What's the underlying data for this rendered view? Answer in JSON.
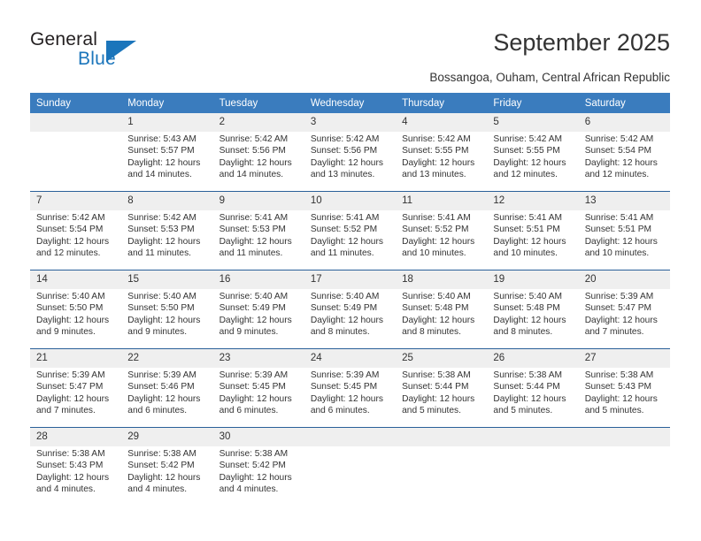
{
  "brand": {
    "name_part1": "General",
    "name_part2": "Blue"
  },
  "header": {
    "title": "September 2025",
    "subtitle": "Bossangoa, Ouham, Central African Republic"
  },
  "colors": {
    "header_blue": "#3a7cbe",
    "rule_blue": "#2a6099",
    "daynum_band": "#efefef",
    "brand_blue": "#1b75bb",
    "text": "#333333"
  },
  "weekday_headers": [
    "Sunday",
    "Monday",
    "Tuesday",
    "Wednesday",
    "Thursday",
    "Friday",
    "Saturday"
  ],
  "weeks": [
    {
      "days": [
        {
          "date": "",
          "sunrise": "",
          "sunset": "",
          "daylight": ""
        },
        {
          "date": "1",
          "sunrise": "Sunrise: 5:43 AM",
          "sunset": "Sunset: 5:57 PM",
          "daylight": "Daylight: 12 hours and 14 minutes."
        },
        {
          "date": "2",
          "sunrise": "Sunrise: 5:42 AM",
          "sunset": "Sunset: 5:56 PM",
          "daylight": "Daylight: 12 hours and 14 minutes."
        },
        {
          "date": "3",
          "sunrise": "Sunrise: 5:42 AM",
          "sunset": "Sunset: 5:56 PM",
          "daylight": "Daylight: 12 hours and 13 minutes."
        },
        {
          "date": "4",
          "sunrise": "Sunrise: 5:42 AM",
          "sunset": "Sunset: 5:55 PM",
          "daylight": "Daylight: 12 hours and 13 minutes."
        },
        {
          "date": "5",
          "sunrise": "Sunrise: 5:42 AM",
          "sunset": "Sunset: 5:55 PM",
          "daylight": "Daylight: 12 hours and 12 minutes."
        },
        {
          "date": "6",
          "sunrise": "Sunrise: 5:42 AM",
          "sunset": "Sunset: 5:54 PM",
          "daylight": "Daylight: 12 hours and 12 minutes."
        }
      ]
    },
    {
      "days": [
        {
          "date": "7",
          "sunrise": "Sunrise: 5:42 AM",
          "sunset": "Sunset: 5:54 PM",
          "daylight": "Daylight: 12 hours and 12 minutes."
        },
        {
          "date": "8",
          "sunrise": "Sunrise: 5:42 AM",
          "sunset": "Sunset: 5:53 PM",
          "daylight": "Daylight: 12 hours and 11 minutes."
        },
        {
          "date": "9",
          "sunrise": "Sunrise: 5:41 AM",
          "sunset": "Sunset: 5:53 PM",
          "daylight": "Daylight: 12 hours and 11 minutes."
        },
        {
          "date": "10",
          "sunrise": "Sunrise: 5:41 AM",
          "sunset": "Sunset: 5:52 PM",
          "daylight": "Daylight: 12 hours and 11 minutes."
        },
        {
          "date": "11",
          "sunrise": "Sunrise: 5:41 AM",
          "sunset": "Sunset: 5:52 PM",
          "daylight": "Daylight: 12 hours and 10 minutes."
        },
        {
          "date": "12",
          "sunrise": "Sunrise: 5:41 AM",
          "sunset": "Sunset: 5:51 PM",
          "daylight": "Daylight: 12 hours and 10 minutes."
        },
        {
          "date": "13",
          "sunrise": "Sunrise: 5:41 AM",
          "sunset": "Sunset: 5:51 PM",
          "daylight": "Daylight: 12 hours and 10 minutes."
        }
      ]
    },
    {
      "days": [
        {
          "date": "14",
          "sunrise": "Sunrise: 5:40 AM",
          "sunset": "Sunset: 5:50 PM",
          "daylight": "Daylight: 12 hours and 9 minutes."
        },
        {
          "date": "15",
          "sunrise": "Sunrise: 5:40 AM",
          "sunset": "Sunset: 5:50 PM",
          "daylight": "Daylight: 12 hours and 9 minutes."
        },
        {
          "date": "16",
          "sunrise": "Sunrise: 5:40 AM",
          "sunset": "Sunset: 5:49 PM",
          "daylight": "Daylight: 12 hours and 9 minutes."
        },
        {
          "date": "17",
          "sunrise": "Sunrise: 5:40 AM",
          "sunset": "Sunset: 5:49 PM",
          "daylight": "Daylight: 12 hours and 8 minutes."
        },
        {
          "date": "18",
          "sunrise": "Sunrise: 5:40 AM",
          "sunset": "Sunset: 5:48 PM",
          "daylight": "Daylight: 12 hours and 8 minutes."
        },
        {
          "date": "19",
          "sunrise": "Sunrise: 5:40 AM",
          "sunset": "Sunset: 5:48 PM",
          "daylight": "Daylight: 12 hours and 8 minutes."
        },
        {
          "date": "20",
          "sunrise": "Sunrise: 5:39 AM",
          "sunset": "Sunset: 5:47 PM",
          "daylight": "Daylight: 12 hours and 7 minutes."
        }
      ]
    },
    {
      "days": [
        {
          "date": "21",
          "sunrise": "Sunrise: 5:39 AM",
          "sunset": "Sunset: 5:47 PM",
          "daylight": "Daylight: 12 hours and 7 minutes."
        },
        {
          "date": "22",
          "sunrise": "Sunrise: 5:39 AM",
          "sunset": "Sunset: 5:46 PM",
          "daylight": "Daylight: 12 hours and 6 minutes."
        },
        {
          "date": "23",
          "sunrise": "Sunrise: 5:39 AM",
          "sunset": "Sunset: 5:45 PM",
          "daylight": "Daylight: 12 hours and 6 minutes."
        },
        {
          "date": "24",
          "sunrise": "Sunrise: 5:39 AM",
          "sunset": "Sunset: 5:45 PM",
          "daylight": "Daylight: 12 hours and 6 minutes."
        },
        {
          "date": "25",
          "sunrise": "Sunrise: 5:38 AM",
          "sunset": "Sunset: 5:44 PM",
          "daylight": "Daylight: 12 hours and 5 minutes."
        },
        {
          "date": "26",
          "sunrise": "Sunrise: 5:38 AM",
          "sunset": "Sunset: 5:44 PM",
          "daylight": "Daylight: 12 hours and 5 minutes."
        },
        {
          "date": "27",
          "sunrise": "Sunrise: 5:38 AM",
          "sunset": "Sunset: 5:43 PM",
          "daylight": "Daylight: 12 hours and 5 minutes."
        }
      ]
    },
    {
      "days": [
        {
          "date": "28",
          "sunrise": "Sunrise: 5:38 AM",
          "sunset": "Sunset: 5:43 PM",
          "daylight": "Daylight: 12 hours and 4 minutes."
        },
        {
          "date": "29",
          "sunrise": "Sunrise: 5:38 AM",
          "sunset": "Sunset: 5:42 PM",
          "daylight": "Daylight: 12 hours and 4 minutes."
        },
        {
          "date": "30",
          "sunrise": "Sunrise: 5:38 AM",
          "sunset": "Sunset: 5:42 PM",
          "daylight": "Daylight: 12 hours and 4 minutes."
        },
        {
          "date": "",
          "sunrise": "",
          "sunset": "",
          "daylight": ""
        },
        {
          "date": "",
          "sunrise": "",
          "sunset": "",
          "daylight": ""
        },
        {
          "date": "",
          "sunrise": "",
          "sunset": "",
          "daylight": ""
        },
        {
          "date": "",
          "sunrise": "",
          "sunset": "",
          "daylight": ""
        }
      ]
    }
  ]
}
